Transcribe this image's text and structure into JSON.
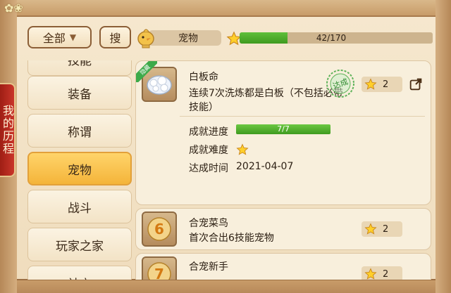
{
  "side_tab": {
    "label": "我的历程"
  },
  "toolbar": {
    "filter_label": "全部",
    "search_label": "搜",
    "category_label": "宠物",
    "progress_text": "42/170",
    "progress_value": 42,
    "progress_max": 170
  },
  "categories": [
    {
      "label": "技能"
    },
    {
      "label": "装备"
    },
    {
      "label": "称谓"
    },
    {
      "label": "宠物"
    },
    {
      "label": "战斗"
    },
    {
      "label": "玩家之家"
    },
    {
      "label": "社交"
    }
  ],
  "achievements": [
    {
      "badge": "隐藏",
      "title": "白板命",
      "desc_line1": "连续7次洗炼都是白板（不包括必带",
      "desc_line2": "技能）",
      "reward": "2",
      "stamp": "达成",
      "progress_label": "成就进度",
      "progress_text": "7/7",
      "progress_value": 7,
      "progress_max": 7,
      "difficulty_label": "成就难度",
      "date_label": "达成时间",
      "date": "2021-04-07"
    },
    {
      "icon_number": "6",
      "title": "合宠菜鸟",
      "desc": "首次合出6技能宠物",
      "reward": "2"
    },
    {
      "icon_number": "7",
      "title": "合宠新手",
      "reward": "2"
    }
  ],
  "colors": {
    "progress_green": "#4caf28",
    "active_tab": "#f4b43a",
    "side_tab_red": "#b32a1e"
  }
}
